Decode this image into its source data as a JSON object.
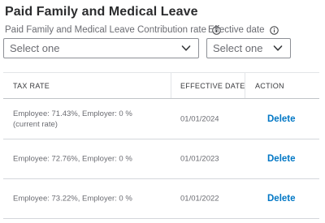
{
  "section": {
    "title": "Paid Family and Medical Leave"
  },
  "filters": {
    "rate_label": "Paid Family and Medical Leave Contribution rate",
    "rate_placeholder": "Select one",
    "date_label": "Effective date",
    "date_placeholder": "Select one"
  },
  "table": {
    "headers": {
      "rate": "TAX RATE",
      "date": "EFFECTIVE DATE",
      "action": "ACTION"
    },
    "rows": [
      {
        "rate": "Employee: 71.43%, Employer: 0 % (current rate)",
        "date": "01/01/2024",
        "action": "Delete"
      },
      {
        "rate": "Employee: 72.76%, Employer: 0 %",
        "date": "01/01/2023",
        "action": "Delete"
      },
      {
        "rate": "Employee: 73.22%, Employer: 0 %",
        "date": "01/01/2022",
        "action": "Delete"
      }
    ]
  },
  "colors": {
    "link": "#0077c5",
    "text": "#393a3d",
    "muted": "#6b6c72",
    "border": "#8d9096"
  },
  "icons": {
    "info": "info-circle-icon",
    "dropdown": "chevron-down-icon"
  }
}
